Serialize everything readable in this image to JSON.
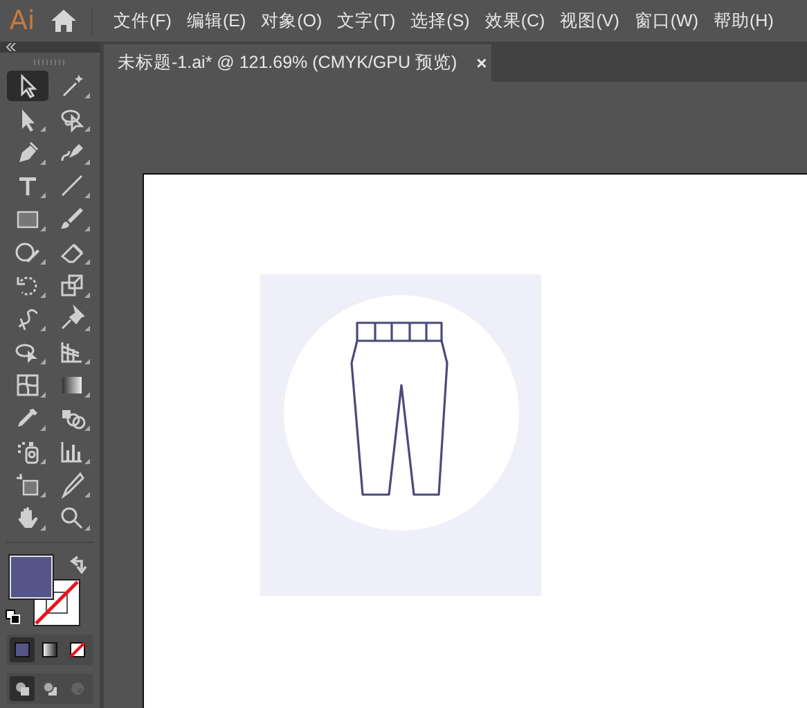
{
  "app": {
    "logo": "Ai"
  },
  "menu": [
    "文件(F)",
    "编辑(E)",
    "对象(O)",
    "文字(T)",
    "选择(S)",
    "效果(C)",
    "视图(V)",
    "窗口(W)",
    "帮助(H)"
  ],
  "document_tab": {
    "title": "未标题-1.ai* @ 121.69% (CMYK/GPU 预览)",
    "close": "×",
    "selected": true
  },
  "tools": [
    {
      "kind": "selection",
      "selected": true
    },
    {
      "kind": "magic-wand",
      "selected": false
    },
    {
      "kind": "direct-selection",
      "selected": false
    },
    {
      "kind": "lasso",
      "selected": false
    },
    {
      "kind": "pen",
      "selected": false
    },
    {
      "kind": "curvature",
      "selected": false
    },
    {
      "kind": "type",
      "selected": false
    },
    {
      "kind": "line",
      "selected": false
    },
    {
      "kind": "rectangle",
      "selected": false
    },
    {
      "kind": "brush",
      "selected": false
    },
    {
      "kind": "shaper",
      "selected": false
    },
    {
      "kind": "eraser",
      "selected": false
    },
    {
      "kind": "rotate",
      "selected": false
    },
    {
      "kind": "scale",
      "selected": false
    },
    {
      "kind": "warp",
      "selected": false
    },
    {
      "kind": "pin",
      "selected": false
    },
    {
      "kind": "free-transform",
      "selected": false
    },
    {
      "kind": "perspective",
      "selected": false
    },
    {
      "kind": "mesh",
      "selected": false
    },
    {
      "kind": "gradient",
      "selected": false
    },
    {
      "kind": "eyedropper",
      "selected": false
    },
    {
      "kind": "blend",
      "selected": false
    },
    {
      "kind": "symbol-sprayer",
      "selected": false
    },
    {
      "kind": "graph",
      "selected": false
    },
    {
      "kind": "artboard",
      "selected": false
    },
    {
      "kind": "slice",
      "selected": false
    },
    {
      "kind": "hand",
      "selected": false
    },
    {
      "kind": "zoom",
      "selected": false
    }
  ],
  "fill": {
    "color": "#55558a"
  },
  "stroke": {
    "none": true
  },
  "color_modes": [
    {
      "kind": "color",
      "selected": true
    },
    {
      "kind": "gradient",
      "selected": false
    },
    {
      "kind": "none",
      "selected": false
    }
  ],
  "draw_modes": [
    {
      "kind": "normal",
      "selected": true
    },
    {
      "kind": "behind",
      "selected": false
    },
    {
      "kind": "inside",
      "selected": false,
      "disabled": true
    }
  ]
}
